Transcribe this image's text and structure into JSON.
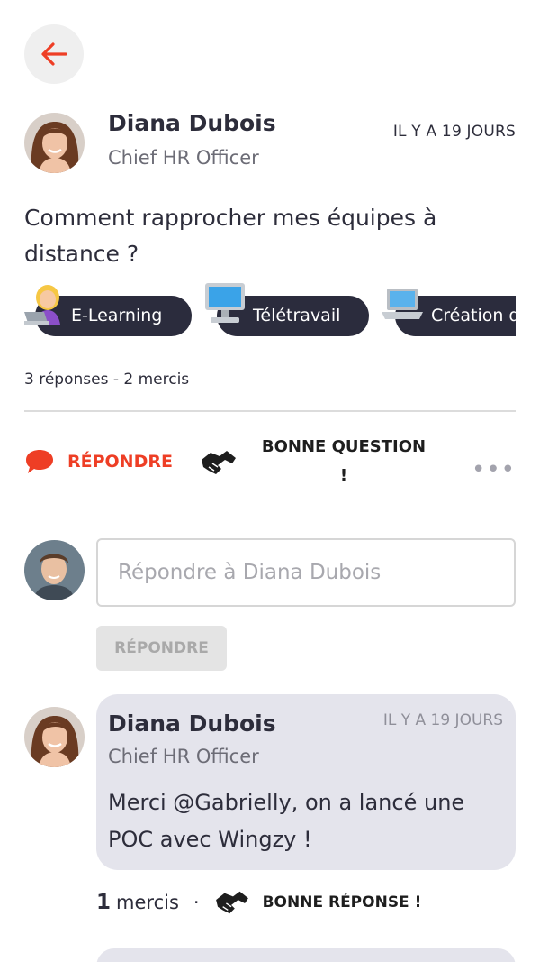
{
  "post": {
    "author_name": "Diana Dubois",
    "author_role": "Chief HR Officer",
    "time": "IL Y A 19 JOURS",
    "question": "Comment rapprocher mes équipes à distance ?",
    "tags": [
      {
        "label": "E-Learning",
        "icon": "woman-laptop-icon"
      },
      {
        "label": "Télétravail",
        "icon": "desktop-computer-icon"
      },
      {
        "label": "Création d",
        "icon": "laptop-icon"
      }
    ],
    "stats": "3 réponses - 2 mercis"
  },
  "actions": {
    "reply_label": "RÉPONDRE",
    "good_question_line1": "BONNE QUESTION",
    "good_question_line2": "!",
    "more_label": "•••"
  },
  "reply_form": {
    "placeholder": "Répondre à Diana Dubois",
    "submit_label": "RÉPONDRE"
  },
  "answers": [
    {
      "author_name": "Diana Dubois",
      "author_role": "Chief HR Officer",
      "time": "IL Y A 19 JOURS",
      "text": "Merci @Gabrielly, on a lancé une POC avec Wingzy !",
      "thanks_count": "1",
      "thanks_label": "mercis",
      "separator": "·",
      "good_answer_label": "BONNE RÉPONSE !"
    }
  ],
  "colors": {
    "accent": "#ee3e25",
    "tag_bg": "#2b2c3d",
    "card_bg": "#e4e4ec"
  }
}
